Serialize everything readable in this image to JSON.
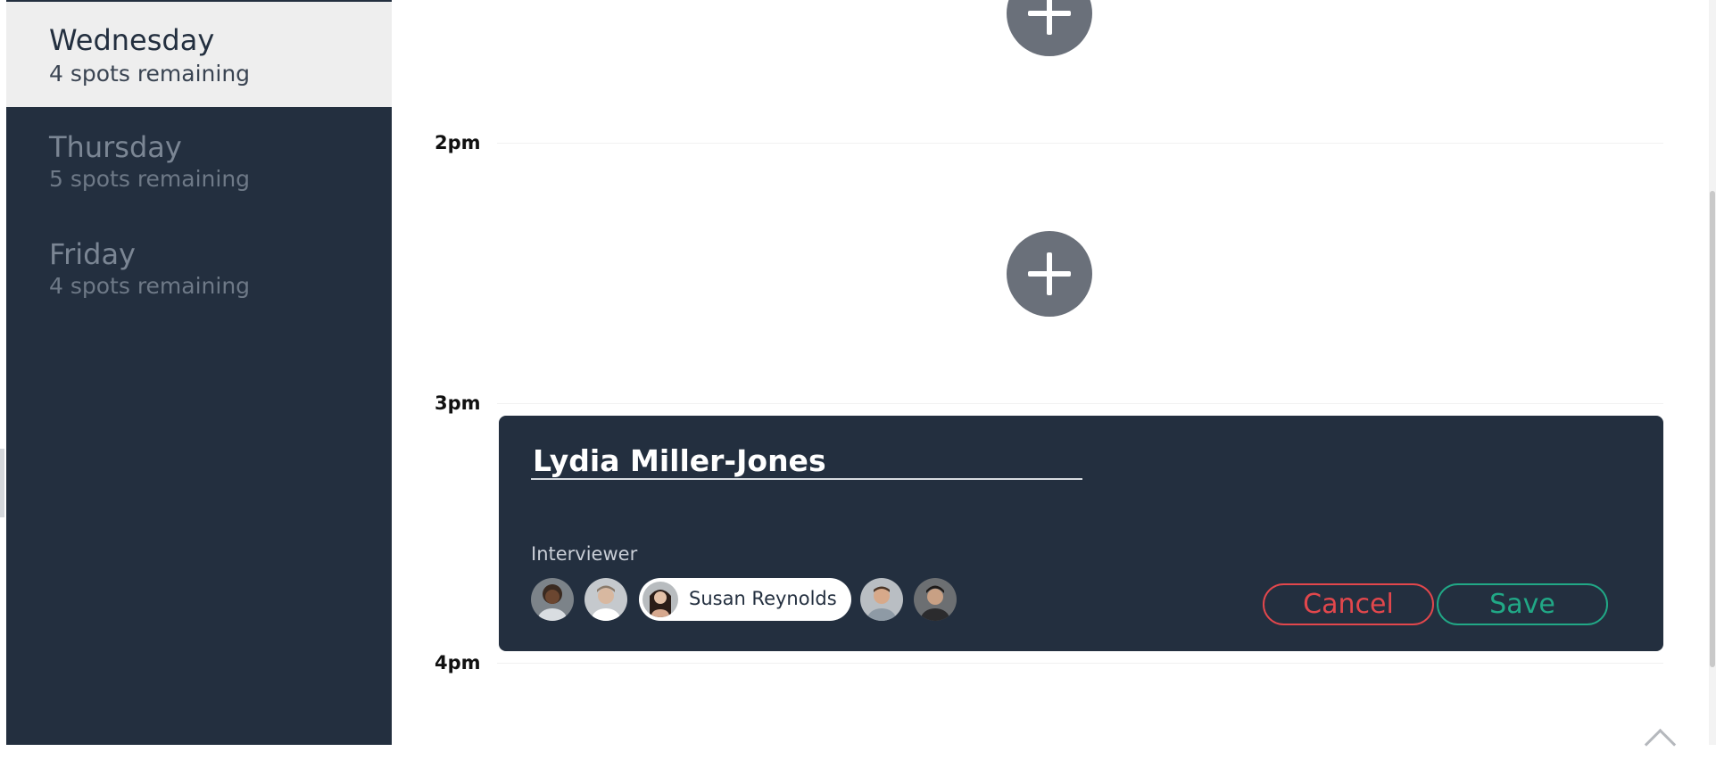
{
  "sidebar": {
    "days": [
      {
        "name": "Wednesday",
        "spots": "4 spots remaining",
        "active": true
      },
      {
        "name": "Thursday",
        "spots": "5 spots remaining",
        "active": false
      },
      {
        "name": "Friday",
        "spots": "4 spots remaining",
        "active": false
      }
    ]
  },
  "schedule": {
    "times": [
      "2pm",
      "3pm",
      "4pm"
    ],
    "add_icon": "plus-icon"
  },
  "booking_card": {
    "candidate_name": "Lydia Miller-Jones",
    "interviewer_label": "Interviewer",
    "interviewers": [
      {
        "name": "",
        "selected": false
      },
      {
        "name": "",
        "selected": false
      },
      {
        "name": "Susan Reynolds",
        "selected": true
      },
      {
        "name": "",
        "selected": false
      },
      {
        "name": "",
        "selected": false
      }
    ],
    "cancel_label": "Cancel",
    "save_label": "Save"
  },
  "colors": {
    "sidebar_bg": "#232f3f",
    "active_day_bg": "#eeeeee",
    "add_button": "#6a707a",
    "cancel": "#e2474c",
    "save": "#21a886"
  }
}
